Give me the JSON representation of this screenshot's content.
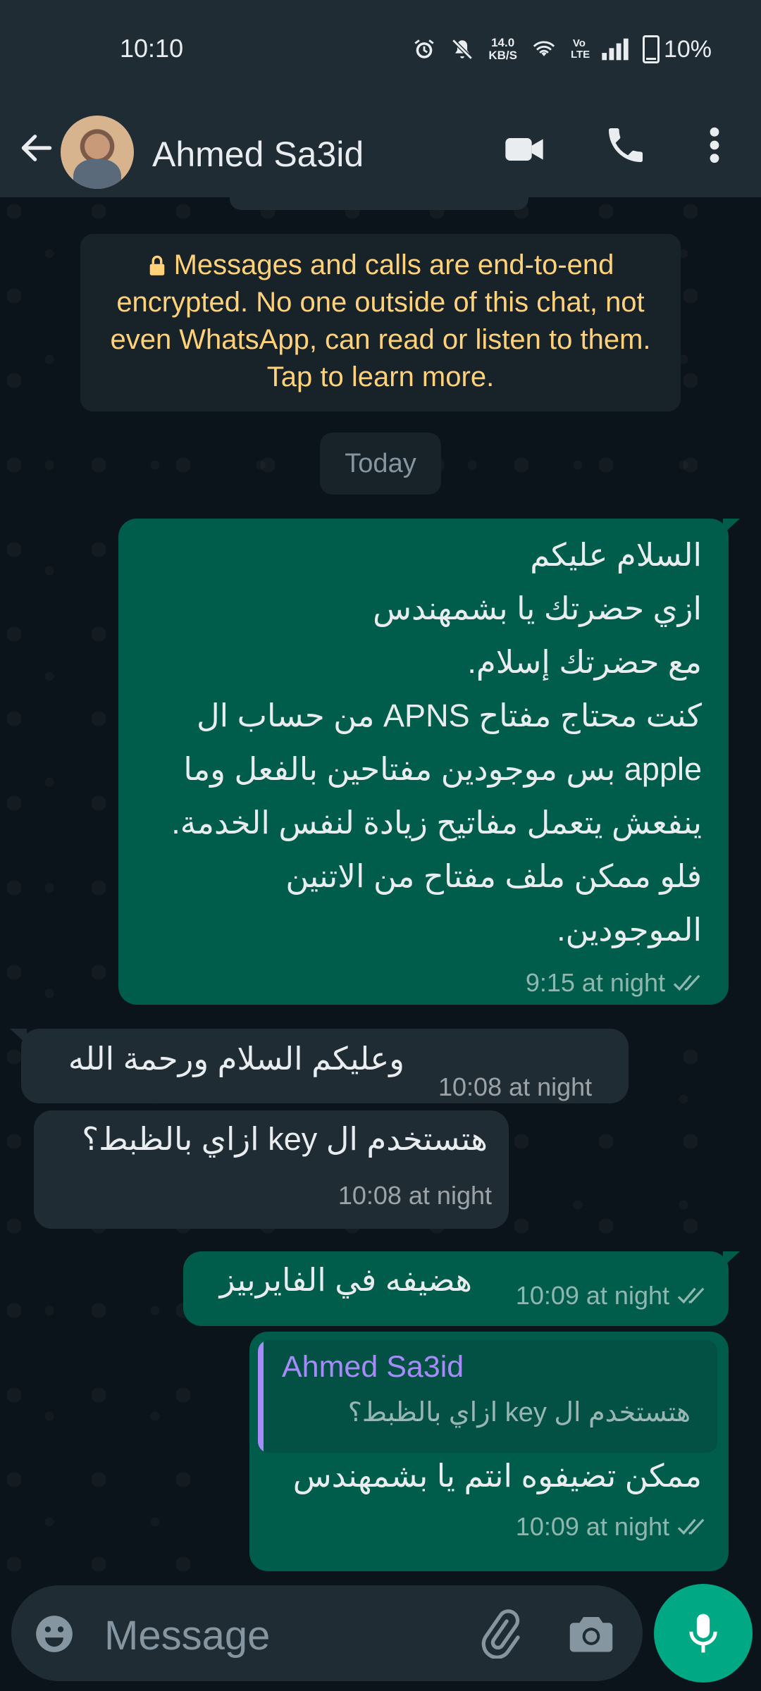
{
  "status_bar": {
    "time": "10:10",
    "speed_value": "14.0",
    "speed_unit": "KB/S",
    "network": "Vo LTE",
    "battery": "10%",
    "battery_level": 0.1
  },
  "header": {
    "contact_name": "Ahmed Sa3id",
    "icons": [
      "back-arrow-icon",
      "video-call-icon",
      "phone-icon",
      "more-vert-icon"
    ]
  },
  "chat": {
    "encryption_notice": "Messages and calls are end-to-end encrypted. No one outside of this chat, not even WhatsApp, can read or listen to them. Tap to learn more.",
    "date_chip": "Today",
    "messages": [
      {
        "direction": "outgoing",
        "text": "السلام عليكم\nازي حضرتك يا بشمهندس\nمع حضرتك إسلام.\nكنت محتاج مفتاح APNS من حساب ال apple بس موجودين مفتاحين بالفعل وما ينفعش يتعمل مفاتيح زيادة لنفس الخدمة. فلو ممكن ملف مفتاح من الاتنين الموجودين.",
        "time": "9:15 at night",
        "status": "read"
      },
      {
        "direction": "incoming",
        "text": "وعليكم السلام ورحمة الله",
        "time": "10:08 at night"
      },
      {
        "direction": "incoming",
        "text": "هتستخدم ال key ازاي بالظبط؟",
        "time": "10:08 at night"
      },
      {
        "direction": "outgoing",
        "text": "هضيفه في الفايربيز",
        "time": "10:09 at night",
        "status": "read"
      },
      {
        "direction": "outgoing",
        "quoted_name": "Ahmed Sa3id",
        "quoted_text": "هتستخدم ال key ازاي بالظبط؟",
        "text": "ممكن تضيفوه انتم يا بشمهندس",
        "time": "10:09 at night",
        "status": "read"
      }
    ]
  },
  "composer": {
    "placeholder": "Message",
    "icons": [
      "emoji-icon",
      "attach-icon",
      "camera-icon",
      "mic-icon"
    ]
  },
  "colors": {
    "header_bg": "#1f2c34",
    "chat_bg": "#0b141a",
    "outgoing_bubble": "#005c4b",
    "incoming_bubble": "#202c33",
    "accent": "#00a884",
    "notice_text": "#ffd279",
    "quote_name": "#a78bfa"
  }
}
